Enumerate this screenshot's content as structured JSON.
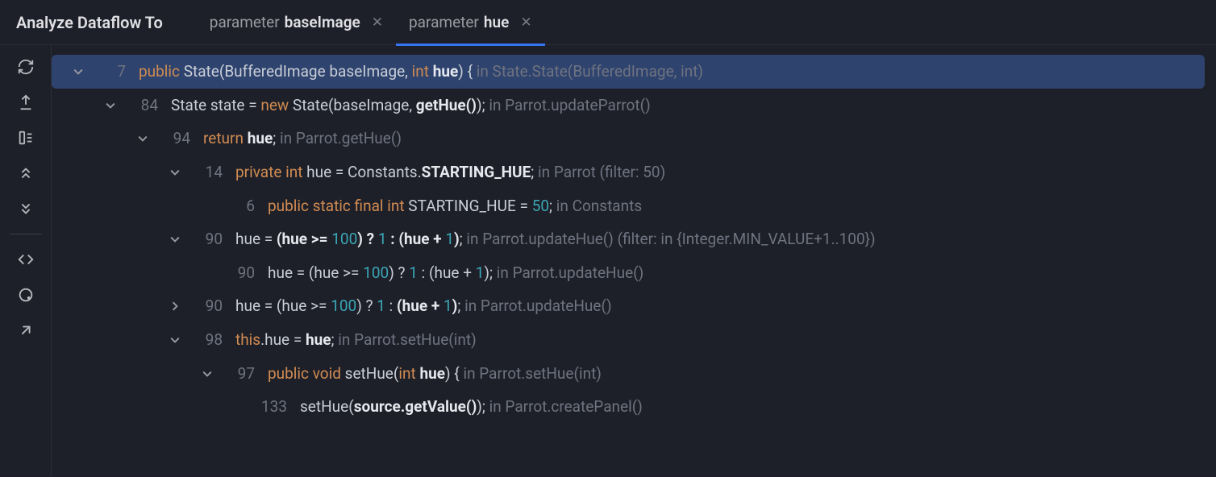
{
  "panel_title": "Analyze Dataflow To",
  "tabs": [
    {
      "prefix": "parameter",
      "name": "baseImage",
      "active": false
    },
    {
      "prefix": "parameter",
      "name": "hue",
      "active": true
    }
  ],
  "toolbar": [
    {
      "id": "refresh-icon"
    },
    {
      "id": "export-icon"
    },
    {
      "id": "expand-icon"
    },
    {
      "id": "prev-icon"
    },
    {
      "id": "next-icon"
    },
    {
      "sep": true
    },
    {
      "id": "code-icon"
    },
    {
      "id": "loop-icon"
    },
    {
      "id": "open-icon"
    }
  ],
  "rows": [
    {
      "indent": 18,
      "chev": "down",
      "selected": true,
      "line": "7",
      "segments": [
        {
          "c": "kw",
          "t": "public"
        },
        {
          "c": "txt",
          "t": " State(BufferedImage baseImage, "
        },
        {
          "c": "kw",
          "t": "int"
        },
        {
          "c": "bold",
          "t": " hue"
        },
        {
          "c": "txt",
          "t": ") {"
        },
        {
          "c": "dim",
          "t": " in State.State(BufferedImage, int)"
        }
      ]
    },
    {
      "indent": 58,
      "chev": "down",
      "line": "84",
      "segments": [
        {
          "c": "txt",
          "t": "State state = "
        },
        {
          "c": "kw",
          "t": "new"
        },
        {
          "c": "txt",
          "t": " State(baseImage, "
        },
        {
          "c": "bold",
          "t": "getHue()"
        },
        {
          "c": "txt",
          "t": ");"
        },
        {
          "c": "dim",
          "t": " in Parrot.updateParrot()"
        }
      ]
    },
    {
      "indent": 98,
      "chev": "down",
      "line": "94",
      "segments": [
        {
          "c": "kw",
          "t": "return"
        },
        {
          "c": "bold",
          "t": " hue"
        },
        {
          "c": "txt",
          "t": ";"
        },
        {
          "c": "dim",
          "t": " in Parrot.getHue()"
        }
      ]
    },
    {
      "indent": 138,
      "chev": "down",
      "line": "14",
      "segments": [
        {
          "c": "kw",
          "t": "private int"
        },
        {
          "c": "txt",
          "t": " hue = Constants."
        },
        {
          "c": "bold",
          "t": "STARTING_HUE"
        },
        {
          "c": "txt",
          "t": ";"
        },
        {
          "c": "dim",
          "t": " in Parrot (filter: 50)"
        }
      ]
    },
    {
      "indent": 178,
      "chev": "blank",
      "line": "6",
      "segments": [
        {
          "c": "kw",
          "t": "public static final int"
        },
        {
          "c": "txt",
          "t": " STARTING_HUE = "
        },
        {
          "c": "num",
          "t": "50"
        },
        {
          "c": "txt",
          "t": ";"
        },
        {
          "c": "dim",
          "t": " in Constants"
        }
      ]
    },
    {
      "indent": 138,
      "chev": "down",
      "line": "90",
      "segments": [
        {
          "c": "txt",
          "t": "hue = "
        },
        {
          "c": "bold",
          "t": "(hue >= "
        },
        {
          "c": "num",
          "t": "100"
        },
        {
          "c": "bold",
          "t": ") ? "
        },
        {
          "c": "num",
          "t": "1"
        },
        {
          "c": "bold",
          "t": " : (hue + "
        },
        {
          "c": "num",
          "t": "1"
        },
        {
          "c": "bold",
          "t": ")"
        },
        {
          "c": "txt",
          "t": ";"
        },
        {
          "c": "dim",
          "t": " in Parrot.updateHue() (filter: in {Integer.MIN_VALUE+1..100})"
        }
      ]
    },
    {
      "indent": 178,
      "chev": "blank",
      "line": "90",
      "segments": [
        {
          "c": "txt",
          "t": "hue = (hue >= "
        },
        {
          "c": "num",
          "t": "100"
        },
        {
          "c": "txt",
          "t": ") ? "
        },
        {
          "c": "num",
          "t": "1"
        },
        {
          "c": "txt",
          "t": " : (hue + "
        },
        {
          "c": "num",
          "t": "1"
        },
        {
          "c": "txt",
          "t": ");"
        },
        {
          "c": "dim",
          "t": " in Parrot.updateHue()"
        }
      ]
    },
    {
      "indent": 138,
      "chev": "right",
      "line": "90",
      "segments": [
        {
          "c": "txt",
          "t": "hue = (hue >= "
        },
        {
          "c": "num",
          "t": "100"
        },
        {
          "c": "txt",
          "t": ") ? "
        },
        {
          "c": "num",
          "t": "1"
        },
        {
          "c": "txt",
          "t": " : "
        },
        {
          "c": "bold",
          "t": "(hue + "
        },
        {
          "c": "num",
          "t": "1"
        },
        {
          "c": "bold",
          "t": ")"
        },
        {
          "c": "txt",
          "t": ";"
        },
        {
          "c": "dim",
          "t": " in Parrot.updateHue()"
        }
      ]
    },
    {
      "indent": 138,
      "chev": "down",
      "line": "98",
      "segments": [
        {
          "c": "kw",
          "t": "this"
        },
        {
          "c": "txt",
          "t": ".hue = "
        },
        {
          "c": "bold",
          "t": "hue"
        },
        {
          "c": "txt",
          "t": ";"
        },
        {
          "c": "dim",
          "t": " in Parrot.setHue(int)"
        }
      ]
    },
    {
      "indent": 178,
      "chev": "down",
      "line": "97",
      "segments": [
        {
          "c": "kw",
          "t": "public void"
        },
        {
          "c": "txt",
          "t": " setHue("
        },
        {
          "c": "kw",
          "t": "int"
        },
        {
          "c": "bold",
          "t": " hue"
        },
        {
          "c": "txt",
          "t": ") {"
        },
        {
          "c": "dim",
          "t": " in Parrot.setHue(int)"
        }
      ]
    },
    {
      "indent": 218,
      "chev": "blank",
      "line": "133",
      "segments": [
        {
          "c": "txt",
          "t": "setHue("
        },
        {
          "c": "bold",
          "t": "source.getValue()"
        },
        {
          "c": "txt",
          "t": ");"
        },
        {
          "c": "dim",
          "t": " in Parrot.createPanel()"
        }
      ]
    }
  ]
}
